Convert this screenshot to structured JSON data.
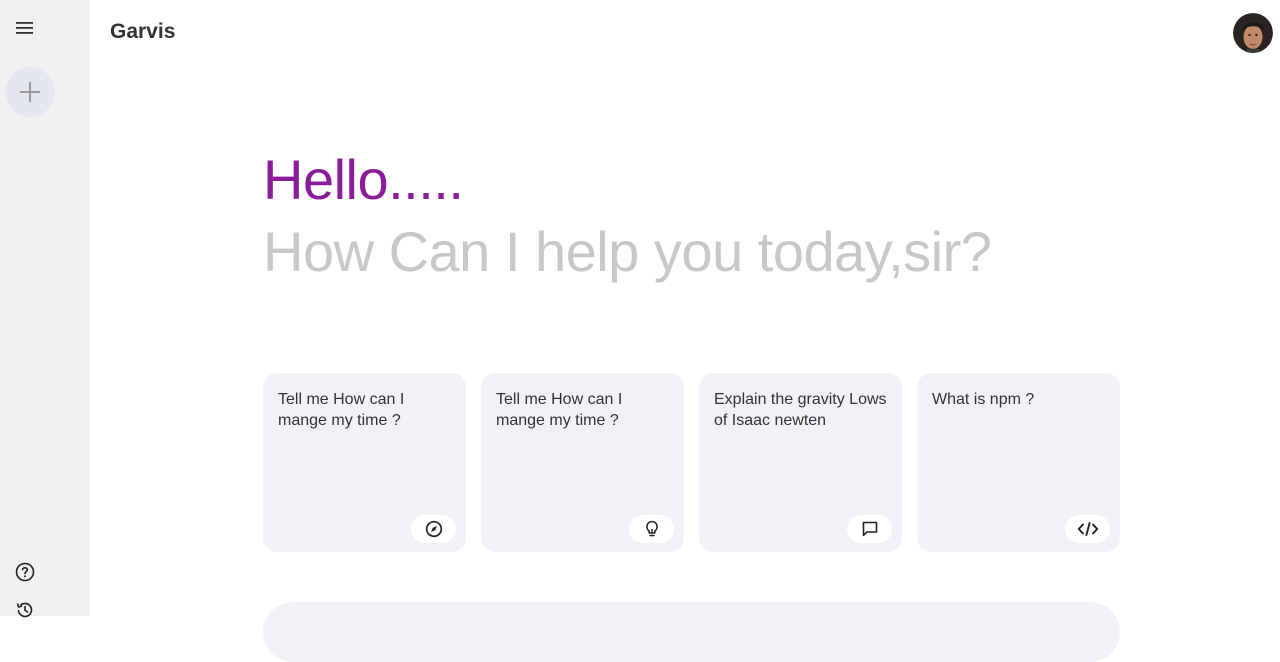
{
  "app": {
    "name": "Garvis"
  },
  "sidebar": {
    "menu_icon": "menu-icon",
    "new_chat_icon": "plus-icon",
    "help_icon": "help-icon",
    "history_icon": "history-icon"
  },
  "main": {
    "greeting": "Hello.....",
    "subtitle": "How Can I help you today,sir?"
  },
  "cards": [
    {
      "text": "Tell me How can I mange my time ?",
      "icon": "compass-icon"
    },
    {
      "text": "Tell me How can I mange my time ?",
      "icon": "bulb-icon"
    },
    {
      "text": "Explain the gravity Lows of Isaac newten",
      "icon": "message-icon"
    },
    {
      "text": "What is npm ?",
      "icon": "code-icon"
    }
  ],
  "colors": {
    "greeting": "#8a1c9a",
    "subtitle": "#c8c8c8",
    "card_bg": "#f0f2f6",
    "sidebar_bg": "#f0f0f0"
  }
}
